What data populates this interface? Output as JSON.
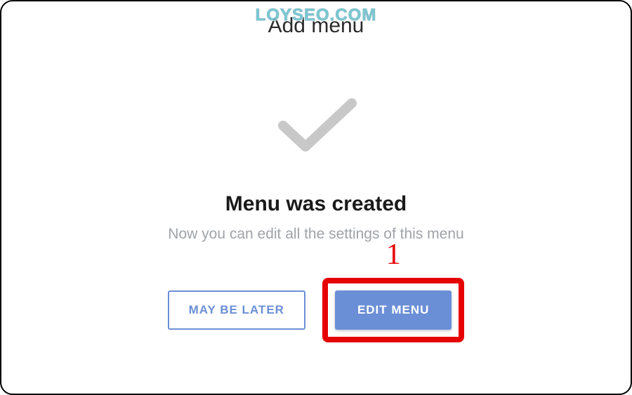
{
  "watermark": "LOYSEO.COM",
  "title": "Add menu",
  "heading": "Menu was created",
  "subtext": "Now you can edit all the settings of this menu",
  "buttons": {
    "later": "MAY BE LATER",
    "edit": "EDIT MENU"
  },
  "annotation": "1",
  "colors": {
    "accent": "#6b8fd6",
    "highlight": "#e60000",
    "muted": "#9fa3a8"
  }
}
